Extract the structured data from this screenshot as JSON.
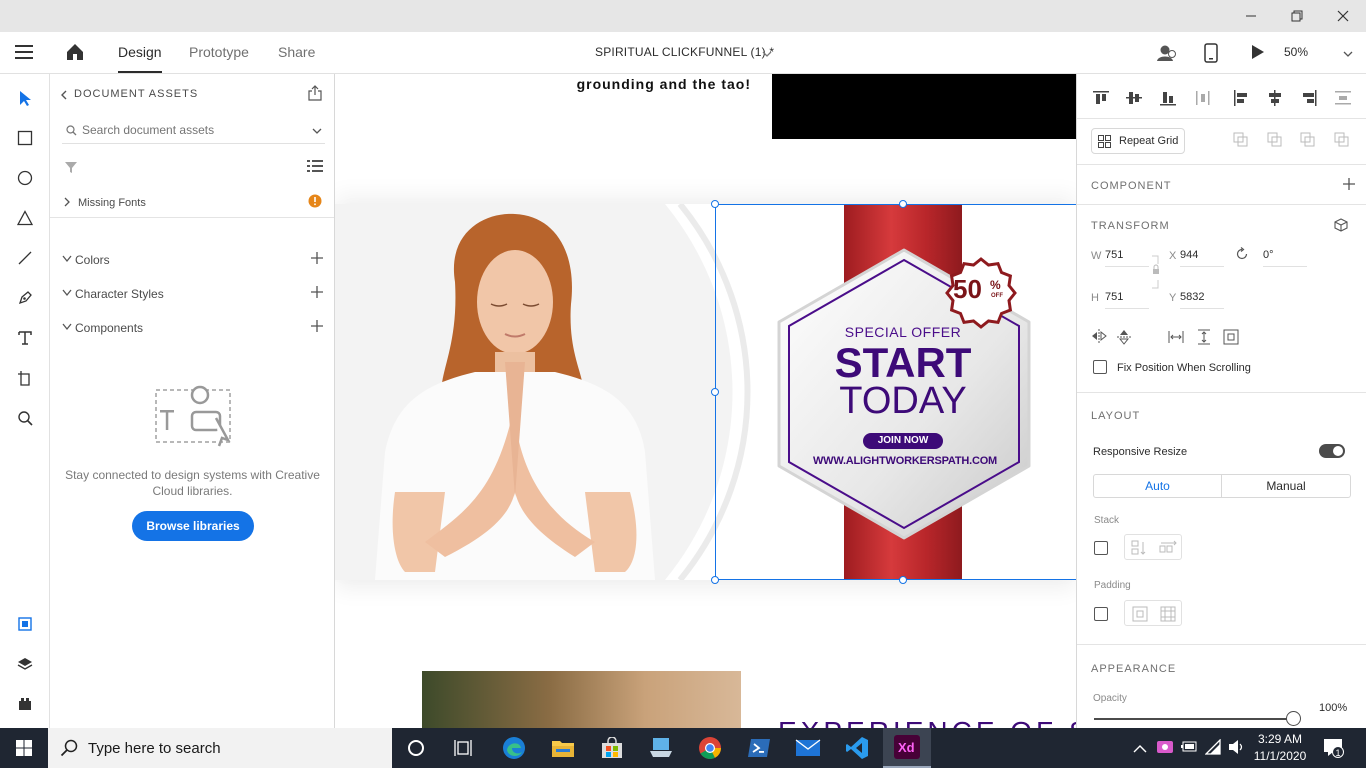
{
  "app": {
    "tabs": [
      "Design",
      "Prototype",
      "Share"
    ],
    "doc_title": "SPIRITUAL  CLICKFUNNEL (1) *",
    "zoom": "50%"
  },
  "assets": {
    "header": "DOCUMENT ASSETS",
    "search_placeholder": "Search document assets",
    "missing_fonts": "Missing Fonts",
    "colors": "Colors",
    "char_styles": "Character Styles",
    "components": "Components",
    "empty_text": "Stay connected to design systems with Creative Cloud libraries.",
    "browse_button": "Browse libraries"
  },
  "canvas": {
    "top_text": "grounding and the tao!",
    "banner_line1": "SPECIAL OFFER",
    "banner_line2": "START",
    "banner_line3": "TODAY",
    "join_button": "JOIN NOW",
    "url": "WWW.ALIGHTWORKERSPATH.COM",
    "badge_num": "50",
    "badge_pct": "%",
    "badge_off": "OFF",
    "bottom_heading": "EXPERIENCE OF SPI"
  },
  "inspector": {
    "repeat_grid": "Repeat Grid",
    "component": "COMPONENT",
    "transform": "TRANSFORM",
    "w_label": "W",
    "w": "751",
    "x_label": "X",
    "x": "944",
    "rot": "0°",
    "h_label": "H",
    "h": "751",
    "y_label": "Y",
    "y": "5832",
    "fix_position": "Fix Position When Scrolling",
    "layout": "LAYOUT",
    "responsive_resize": "Responsive Resize",
    "auto": "Auto",
    "manual": "Manual",
    "stack": "Stack",
    "padding": "Padding",
    "appearance": "APPEARANCE",
    "opacity_label": "Opacity",
    "opacity": "100%"
  },
  "taskbar": {
    "search_placeholder": "Type here to search",
    "time": "3:29 AM",
    "date": "11/1/2020",
    "notif_count": "1"
  },
  "colors": {
    "accent": "#1473e6",
    "purple": "#4a0d8a",
    "red": "#c0262c",
    "taskbar": "#1f2632"
  }
}
